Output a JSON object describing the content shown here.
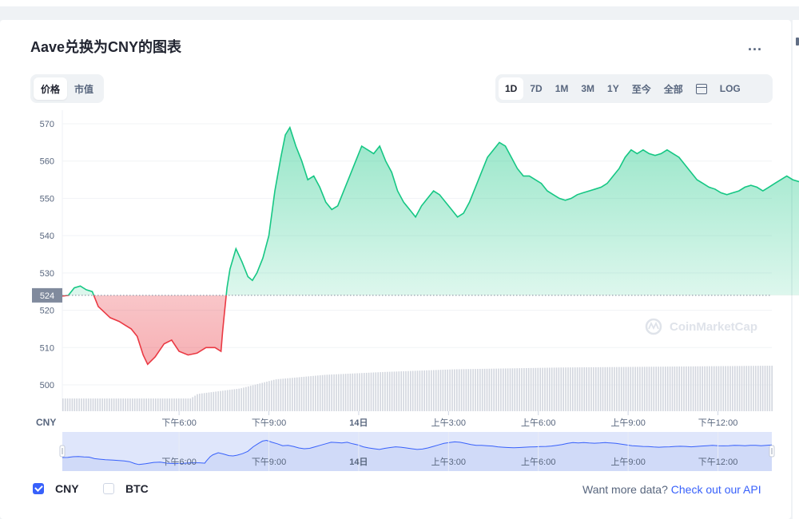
{
  "title": "Aave兑换为CNY的图表",
  "more_label": "...",
  "metric_tabs": [
    {
      "label": "价格",
      "active": true
    },
    {
      "label": "市值",
      "active": false
    }
  ],
  "range_tabs": [
    {
      "label": "1D",
      "active": true
    },
    {
      "label": "7D",
      "active": false
    },
    {
      "label": "1M",
      "active": false
    },
    {
      "label": "3M",
      "active": false
    },
    {
      "label": "1Y",
      "active": false
    },
    {
      "label": "至今",
      "active": false
    },
    {
      "label": "全部",
      "active": false
    }
  ],
  "calendar_icon": "calendar-icon",
  "log_label": "LOG",
  "currency_axis_label": "CNY",
  "watermark": "CoinMarketCap",
  "checkboxes": [
    {
      "label": "CNY",
      "checked": true
    },
    {
      "label": "BTC",
      "checked": false
    }
  ],
  "api_prefix": "Want more data?",
  "api_link": "Check out our API",
  "colors": {
    "up": "#16c784",
    "down": "#ea3943",
    "accent": "#3861fb",
    "volume": "#d2d6de",
    "navigator_fill": "#dfe6fb",
    "navigator_line": "#3861fb"
  },
  "chart_data": {
    "type": "line",
    "y_ticks": [
      500,
      510,
      520,
      530,
      540,
      550,
      560,
      570
    ],
    "ylim": [
      497,
      572
    ],
    "reference_value": 524,
    "reference_label": "524",
    "x_ticks": [
      {
        "t": 6,
        "label": "下午6:00"
      },
      {
        "t": 9,
        "label": "下午9:00"
      },
      {
        "t": 12,
        "label": "14日"
      },
      {
        "t": 15,
        "label": "上午3:00"
      },
      {
        "t": 18,
        "label": "上午6:00"
      },
      {
        "t": 21,
        "label": "上午9:00"
      },
      {
        "t": 24,
        "label": "下午12:00"
      }
    ],
    "xlim": [
      2.1,
      25.8
    ],
    "series": [
      {
        "values": [
          [
            2.1,
            523.8
          ],
          [
            2.3,
            524
          ],
          [
            2.5,
            526
          ],
          [
            2.7,
            526.5
          ],
          [
            2.9,
            525.5
          ],
          [
            3.1,
            525
          ],
          [
            3.3,
            521
          ],
          [
            3.5,
            519.5
          ],
          [
            3.7,
            518
          ],
          [
            4.0,
            517
          ],
          [
            4.2,
            516
          ],
          [
            4.4,
            515
          ],
          [
            4.6,
            513
          ],
          [
            4.8,
            508
          ],
          [
            4.95,
            505.5
          ],
          [
            5.2,
            507.5
          ],
          [
            5.5,
            511
          ],
          [
            5.75,
            512
          ],
          [
            6.0,
            509
          ],
          [
            6.3,
            508
          ],
          [
            6.6,
            508.5
          ],
          [
            6.9,
            510
          ],
          [
            7.2,
            510
          ],
          [
            7.4,
            509
          ],
          [
            7.45,
            514
          ],
          [
            7.5,
            518
          ],
          [
            7.55,
            522
          ],
          [
            7.6,
            526
          ],
          [
            7.7,
            531
          ],
          [
            7.9,
            536.5
          ],
          [
            8.1,
            533
          ],
          [
            8.3,
            529
          ],
          [
            8.45,
            528
          ],
          [
            8.6,
            530
          ],
          [
            8.8,
            534
          ],
          [
            9.0,
            540
          ],
          [
            9.2,
            552
          ],
          [
            9.4,
            561
          ],
          [
            9.55,
            567
          ],
          [
            9.7,
            569
          ],
          [
            9.9,
            564
          ],
          [
            10.1,
            560
          ],
          [
            10.3,
            555
          ],
          [
            10.5,
            556
          ],
          [
            10.7,
            553
          ],
          [
            10.9,
            549
          ],
          [
            11.1,
            547
          ],
          [
            11.3,
            548
          ],
          [
            11.5,
            552
          ],
          [
            11.7,
            556
          ],
          [
            11.9,
            560
          ],
          [
            12.1,
            564
          ],
          [
            12.3,
            563
          ],
          [
            12.5,
            562
          ],
          [
            12.7,
            564
          ],
          [
            12.9,
            560
          ],
          [
            13.1,
            557
          ],
          [
            13.3,
            552
          ],
          [
            13.5,
            549
          ],
          [
            13.7,
            547
          ],
          [
            13.9,
            545
          ],
          [
            14.1,
            548
          ],
          [
            14.3,
            550
          ],
          [
            14.5,
            552
          ],
          [
            14.7,
            551
          ],
          [
            14.9,
            549
          ],
          [
            15.1,
            547
          ],
          [
            15.3,
            545
          ],
          [
            15.5,
            546
          ],
          [
            15.7,
            549
          ],
          [
            15.9,
            553
          ],
          [
            16.1,
            557
          ],
          [
            16.3,
            561
          ],
          [
            16.5,
            563
          ],
          [
            16.7,
            565
          ],
          [
            16.9,
            564
          ],
          [
            17.1,
            561
          ],
          [
            17.3,
            558
          ],
          [
            17.5,
            556
          ],
          [
            17.7,
            556
          ],
          [
            17.9,
            555
          ],
          [
            18.1,
            554
          ],
          [
            18.3,
            552
          ],
          [
            18.5,
            551
          ],
          [
            18.7,
            550
          ],
          [
            18.9,
            549.5
          ],
          [
            19.1,
            550
          ],
          [
            19.3,
            551
          ],
          [
            19.5,
            551.5
          ],
          [
            19.7,
            552
          ],
          [
            19.9,
            552.5
          ],
          [
            20.1,
            553
          ],
          [
            20.3,
            554
          ],
          [
            20.5,
            556
          ],
          [
            20.7,
            558
          ],
          [
            20.9,
            561
          ],
          [
            21.1,
            563
          ],
          [
            21.3,
            562
          ],
          [
            21.5,
            563
          ],
          [
            21.7,
            562
          ],
          [
            21.9,
            561.5
          ],
          [
            22.1,
            562
          ],
          [
            22.3,
            563
          ],
          [
            22.5,
            562
          ],
          [
            22.7,
            561
          ],
          [
            22.9,
            559
          ],
          [
            23.1,
            557
          ],
          [
            23.3,
            555
          ],
          [
            23.5,
            554
          ],
          [
            23.7,
            553
          ],
          [
            23.9,
            552.5
          ],
          [
            24.1,
            551.5
          ],
          [
            24.3,
            551
          ],
          [
            24.5,
            551.5
          ],
          [
            24.7,
            552
          ],
          [
            24.9,
            553
          ],
          [
            25.1,
            553.5
          ],
          [
            25.3,
            553
          ],
          [
            25.5,
            552
          ],
          [
            25.7,
            553
          ],
          [
            25.9,
            554
          ],
          [
            26.1,
            555
          ],
          [
            26.3,
            556
          ],
          [
            26.5,
            555
          ],
          [
            26.7,
            554.5
          ],
          [
            26.9,
            555
          ],
          [
            27.1,
            556
          ],
          [
            27.3,
            555.5
          ],
          [
            27.5,
            555
          ],
          [
            27.7,
            556
          ],
          [
            27.9,
            556
          ],
          [
            28.1,
            555
          ],
          [
            28.3,
            556
          ],
          [
            28.5,
            557
          ]
        ]
      }
    ],
    "volume_profile": [
      [
        0,
        0.28
      ],
      [
        0.18,
        0.28
      ],
      [
        0.19,
        0.38
      ],
      [
        0.25,
        0.5
      ],
      [
        0.3,
        0.7
      ],
      [
        0.37,
        0.8
      ],
      [
        0.45,
        0.86
      ],
      [
        0.55,
        0.92
      ],
      [
        0.7,
        0.96
      ],
      [
        1.0,
        1.0
      ]
    ],
    "navigator_ticks": [
      "下午6:00",
      "下午9:00",
      "14日",
      "上午3:00",
      "上午6:00",
      "上午9:00",
      "下午12:00"
    ]
  }
}
